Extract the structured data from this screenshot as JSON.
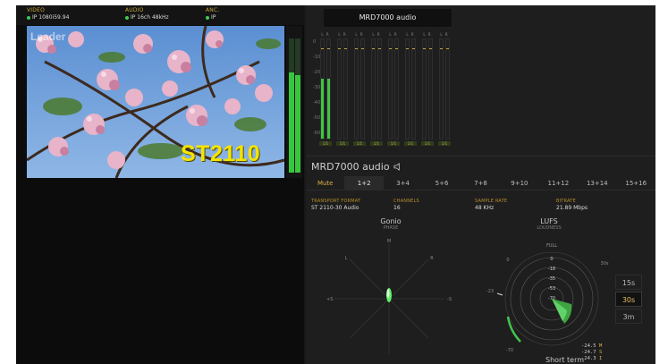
{
  "status": {
    "video": {
      "head": "VIDEO",
      "value": "IP 1080i59.94"
    },
    "audio": {
      "head": "AUDIO",
      "value": "IP 16ch 48kHz"
    },
    "anc": {
      "head": "ANC.",
      "value": "IP"
    }
  },
  "video": {
    "logo": "Leader",
    "overlay_text": "ST2110",
    "mini_meter_levels": [
      0.75,
      0.73
    ]
  },
  "meter_bank": {
    "title": "MRD7000 audio",
    "scale": [
      "0",
      "-10",
      "-20",
      "-30",
      "-40",
      "-50",
      "-60"
    ],
    "lr_label": "L R",
    "foot_label": "1/1",
    "channels": [
      {
        "level": 0.6
      },
      {
        "level": 0.0
      },
      {
        "level": 0.0
      },
      {
        "level": 0.0
      },
      {
        "level": 0.0
      },
      {
        "level": 0.0
      },
      {
        "level": 0.0
      },
      {
        "level": 0.0
      }
    ]
  },
  "panel": {
    "title": "MRD7000 audio",
    "tabs": [
      {
        "label": "Mute",
        "state": "mute"
      },
      {
        "label": "1+2",
        "state": "active"
      },
      {
        "label": "3+4",
        "state": ""
      },
      {
        "label": "5+6",
        "state": ""
      },
      {
        "label": "7+8",
        "state": ""
      },
      {
        "label": "9+10",
        "state": ""
      },
      {
        "label": "11+12",
        "state": ""
      },
      {
        "label": "13+14",
        "state": ""
      },
      {
        "label": "15+16",
        "state": ""
      }
    ],
    "info": {
      "transport_head": "TRANSPORT FORMAT",
      "transport_val": "ST 2110-30 Audio",
      "channels_head": "CHANNELS",
      "channels_val": "16",
      "rate_head": "SAMPLE RATE",
      "rate_val": "48 KHz",
      "bitrate_head": "BITRATE",
      "bitrate_val": "21.89 Mbps"
    }
  },
  "gonio": {
    "title": "Gonio",
    "subtitle": "PHASE",
    "m": "M",
    "l": "L",
    "r": "R",
    "plus_s": "+S",
    "minus_s": "-S"
  },
  "lufs": {
    "title": "LUFS",
    "subtitle": "LOUDNESS",
    "full": "FULL",
    "rings": [
      "0",
      "-18",
      "-35",
      "-53",
      "-70"
    ],
    "arc_top": "0",
    "arc_left": "-23",
    "arc_bottom": "-70",
    "time_label": "30s",
    "time_buttons": [
      {
        "label": "15s",
        "active": false
      },
      {
        "label": "30s",
        "active": true
      },
      {
        "label": "3m",
        "active": false
      }
    ],
    "readouts": [
      {
        "value": "-24.5",
        "tag": "M"
      },
      {
        "value": "-24.7",
        "tag": "S"
      },
      {
        "value": "-24.3",
        "tag": "I"
      }
    ],
    "footer": "Short term"
  },
  "colors": {
    "accent": "#c9a63a",
    "meter_green": "#41c444",
    "overlay_yellow": "#f4e400",
    "status_green": "#3fcc4f"
  }
}
